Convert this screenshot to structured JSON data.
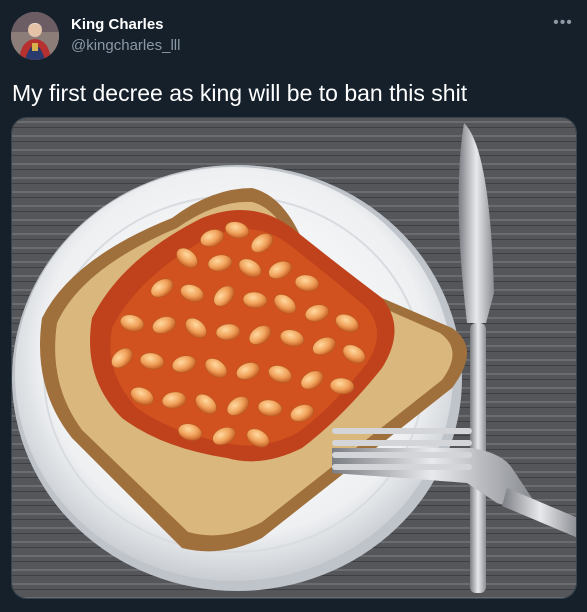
{
  "user": {
    "name": "King Charles",
    "handle": "@kingcharles_lll"
  },
  "tweet": {
    "text": "My first decree as king will be to ban this shit"
  },
  "icons": {
    "more": "more-horizontal-icon"
  },
  "photo": {
    "subject": "beans-on-toast-photo"
  }
}
